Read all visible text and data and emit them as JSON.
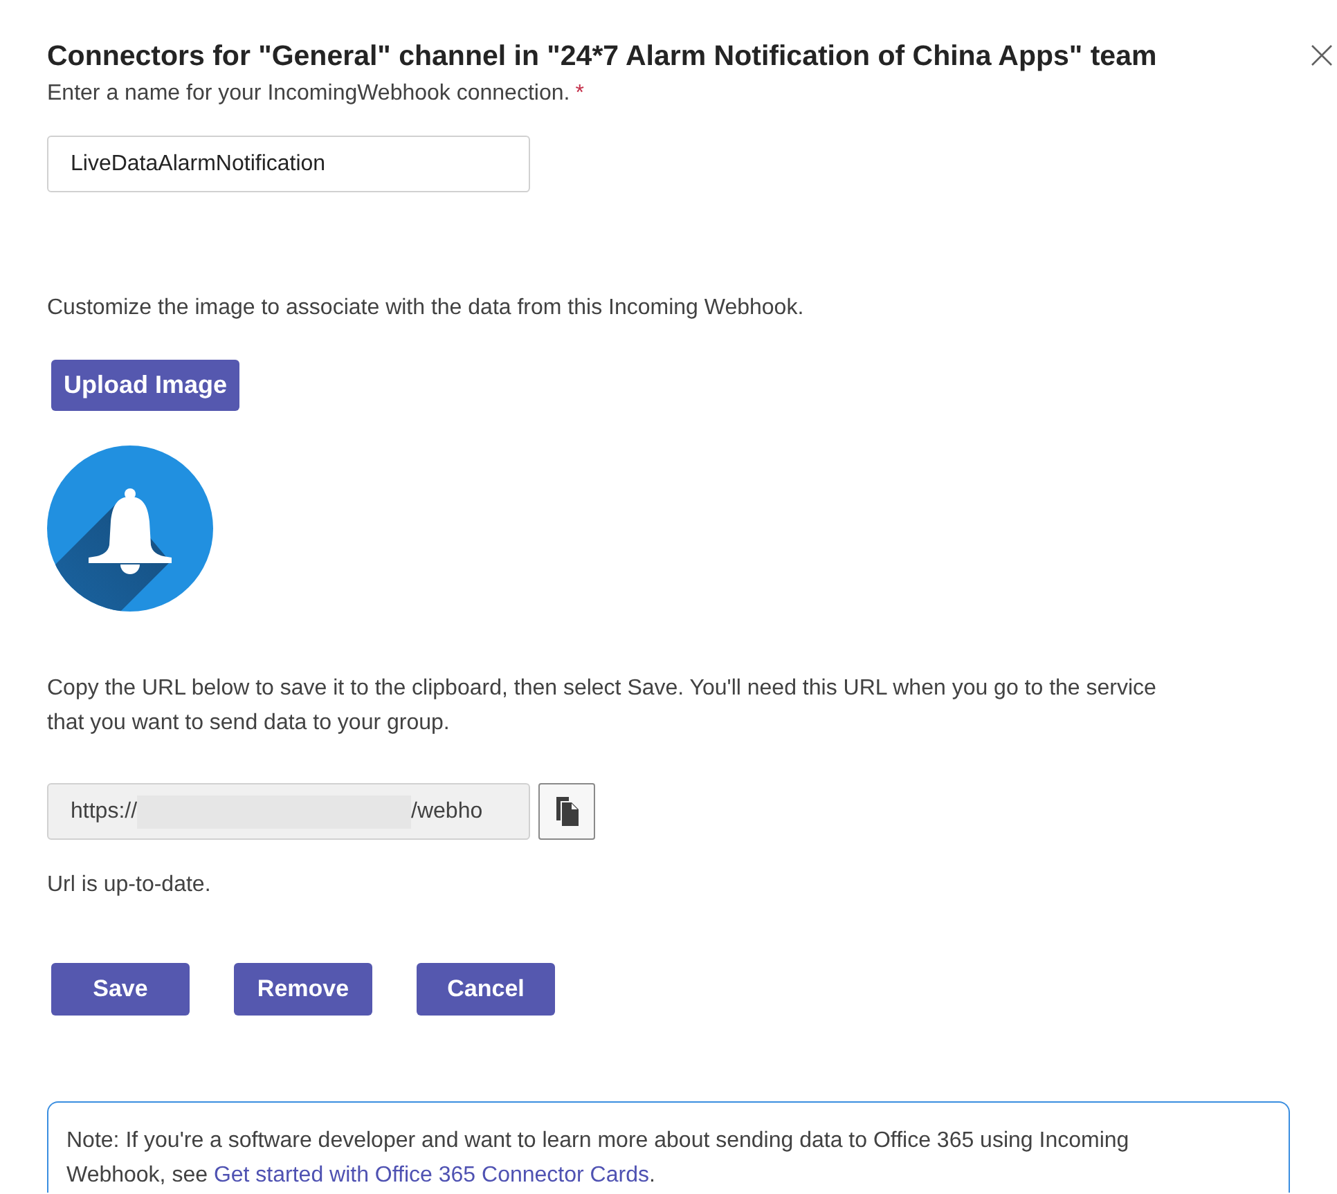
{
  "dialog": {
    "title": "Connectors for \"General\" channel in \"24*7 Alarm Notification of China Apps\" team"
  },
  "name_field": {
    "label": "Enter a name for your IncomingWebhook connection.",
    "required_mark": "*",
    "value": "LiveDataAlarmNotification"
  },
  "image_section": {
    "description": "Customize the image to associate with the data from this Incoming Webhook.",
    "upload_button": "Upload Image"
  },
  "url_section": {
    "instructions": "Copy the URL below to save it to the clipboard, then select Save. You'll need this URL when you go to the service that you want to send data to your group.",
    "url_start": "https://",
    "url_end": "/webho",
    "status": "Url is up-to-date."
  },
  "buttons": [
    {
      "label": "Save"
    },
    {
      "label": "Remove"
    },
    {
      "label": "Cancel"
    }
  ],
  "note": {
    "text": "Note: If you're a software developer and want to learn more about sending data to Office 365 using Incoming Webhook, see ",
    "link": "Get started with Office 365 Connector Cards",
    "text_after": "."
  }
}
